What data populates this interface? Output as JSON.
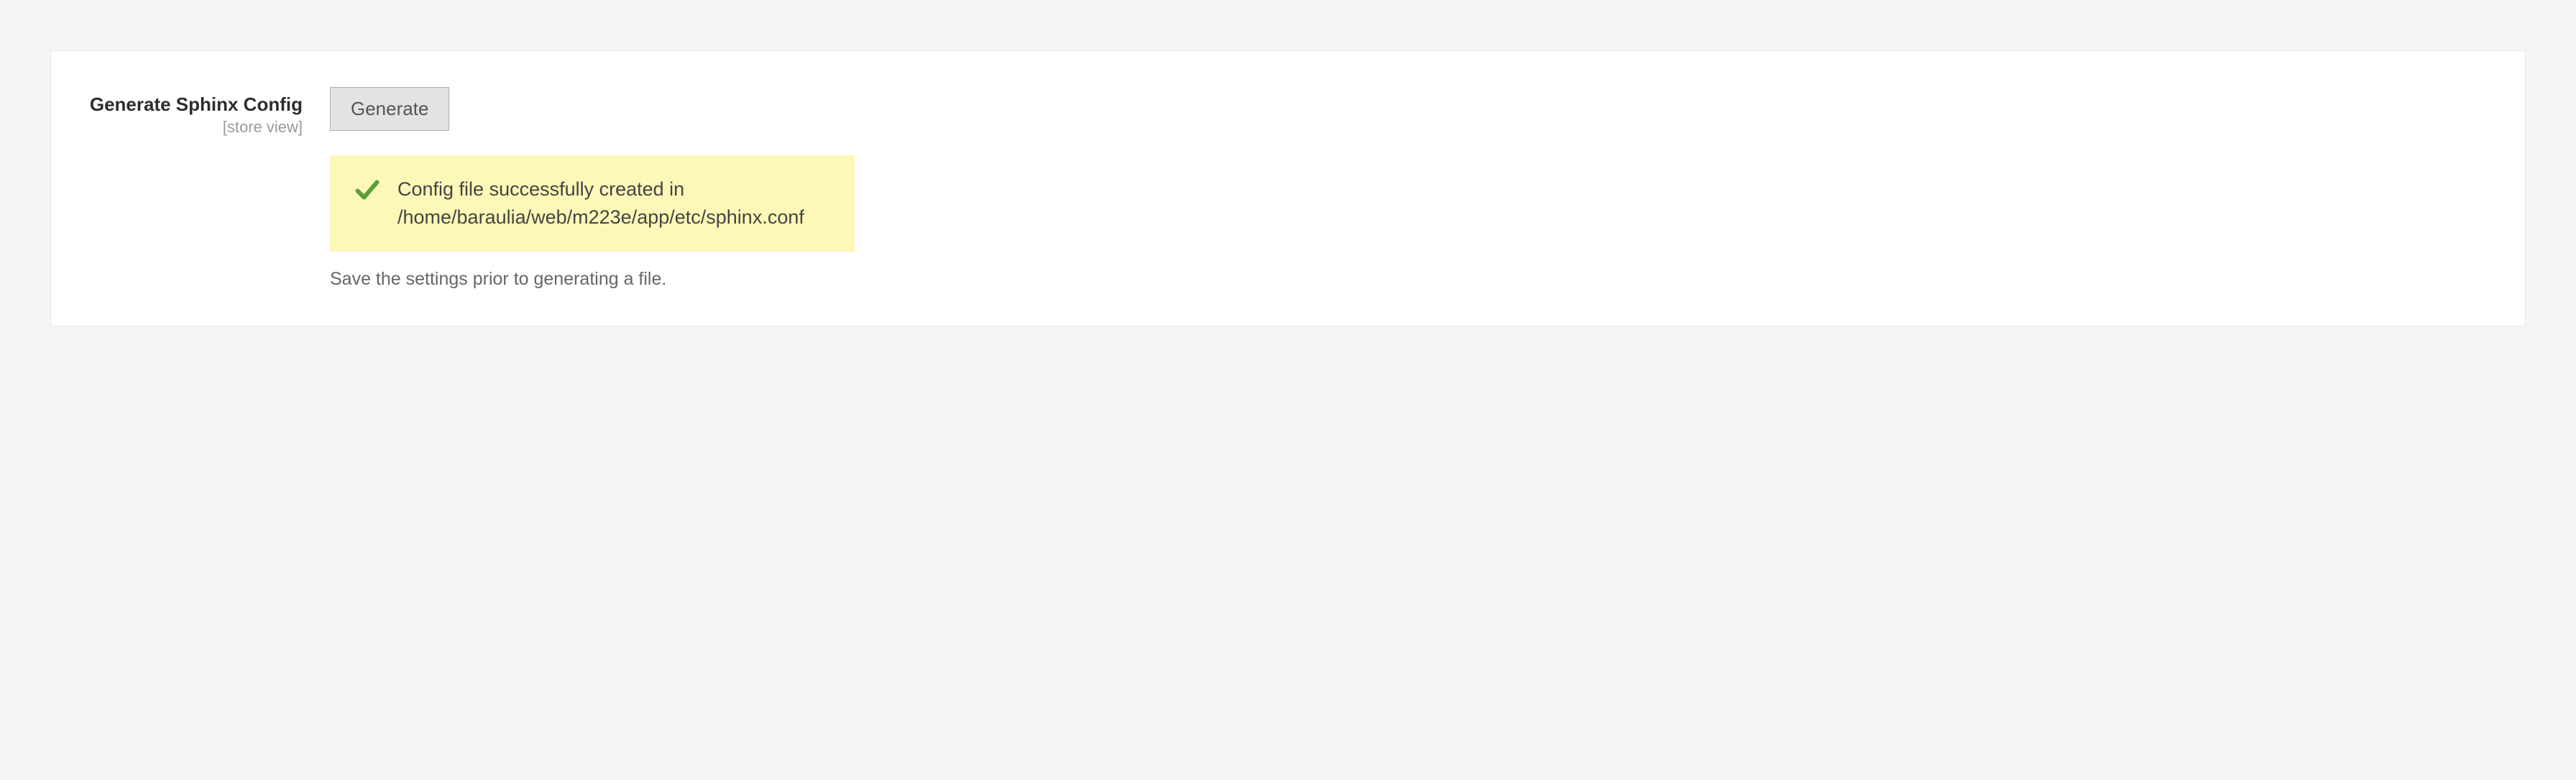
{
  "field": {
    "label": "Generate Sphinx Config",
    "scope": "[store view]",
    "button": "Generate",
    "note": "Save the settings prior to generating a file."
  },
  "message": {
    "text": "Config file successfully created in /home/baraulia/web/m223e/app/etc/sphinx.conf"
  },
  "colors": {
    "success": "#5b9f3b",
    "noticeBg": "#fdf8b7"
  }
}
